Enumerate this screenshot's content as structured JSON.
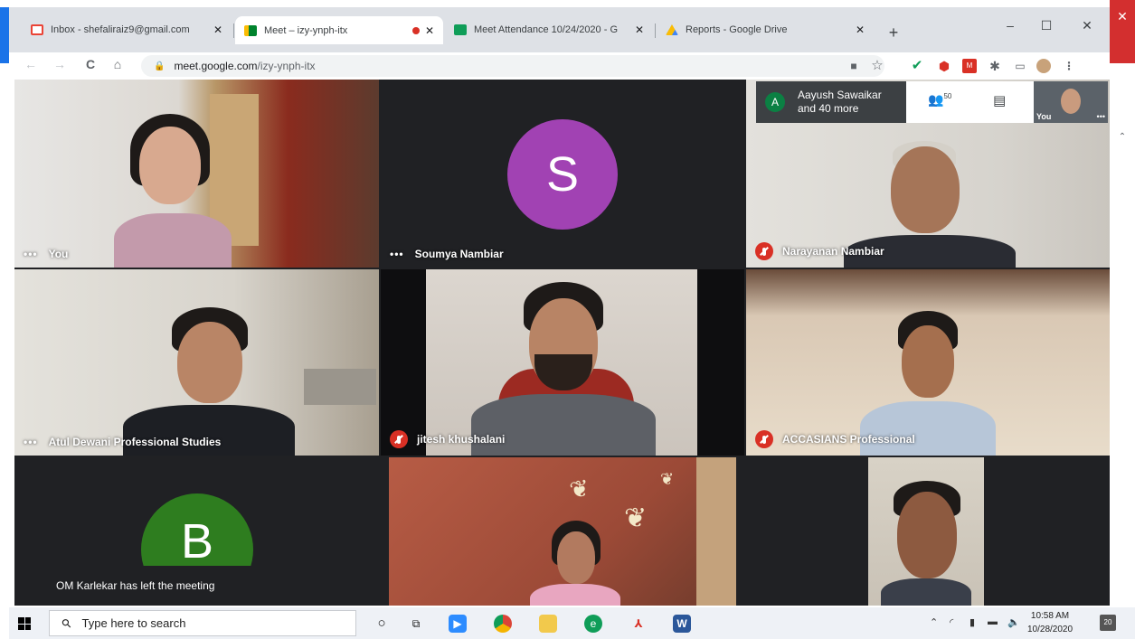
{
  "browser": {
    "tabs": [
      {
        "title": "Inbox - shefaliraiz9@gmail.com",
        "favicon": "gmail-icon",
        "color": "#ea4335"
      },
      {
        "title": "Meet – izy-ynph-itx",
        "favicon": "meet-icon",
        "color": "#00832d",
        "recording": true
      },
      {
        "title": "Meet Attendance 10/24/2020 - G",
        "favicon": "sheets-icon",
        "color": "#0f9d58"
      },
      {
        "title": "Reports - Google Drive",
        "favicon": "drive-icon",
        "color": "#fbbc04"
      }
    ],
    "new_tab": "+",
    "window_controls": {
      "minimize": "–",
      "maximize": "☐",
      "close": "✕"
    },
    "nav": {
      "back": "←",
      "forward": "→",
      "reload": "C",
      "home": "⌂"
    },
    "url_host": "meet.google.com",
    "url_path": "/izy-ynph-itx",
    "lock": "🔒",
    "star": "☆"
  },
  "meet": {
    "participants": [
      {
        "name": "You",
        "muted": false,
        "type": "video"
      },
      {
        "name": "Soumya Nambiar",
        "muted": false,
        "type": "avatar",
        "initial": "S",
        "avatar_color": "#a142b3"
      },
      {
        "name": "Narayanan Nambiar",
        "muted": true,
        "type": "video"
      },
      {
        "name": "Atul Dewani Professional Studies",
        "muted": false,
        "type": "video"
      },
      {
        "name": "jitesh khushalani",
        "muted": true,
        "type": "video"
      },
      {
        "name": "ACCASIANS Professional",
        "muted": true,
        "type": "video"
      },
      {
        "name": "",
        "muted": false,
        "type": "avatar",
        "initial": "B",
        "avatar_color": "#2e7d1f"
      },
      {
        "name": "",
        "muted": false,
        "type": "video"
      },
      {
        "name": "",
        "muted": false,
        "type": "video"
      }
    ],
    "overlay": {
      "avatar_initial": "A",
      "name_line1": "Aayush Sawaikar",
      "name_line2": "and 40 more",
      "people_count": "50",
      "self_label": "You"
    },
    "toast": "OM Karlekar has left the meeting"
  },
  "taskbar": {
    "search_placeholder": "Type here to search",
    "clock_time": "10:58 AM",
    "clock_date": "10/28/2020",
    "notification_count": "20"
  }
}
